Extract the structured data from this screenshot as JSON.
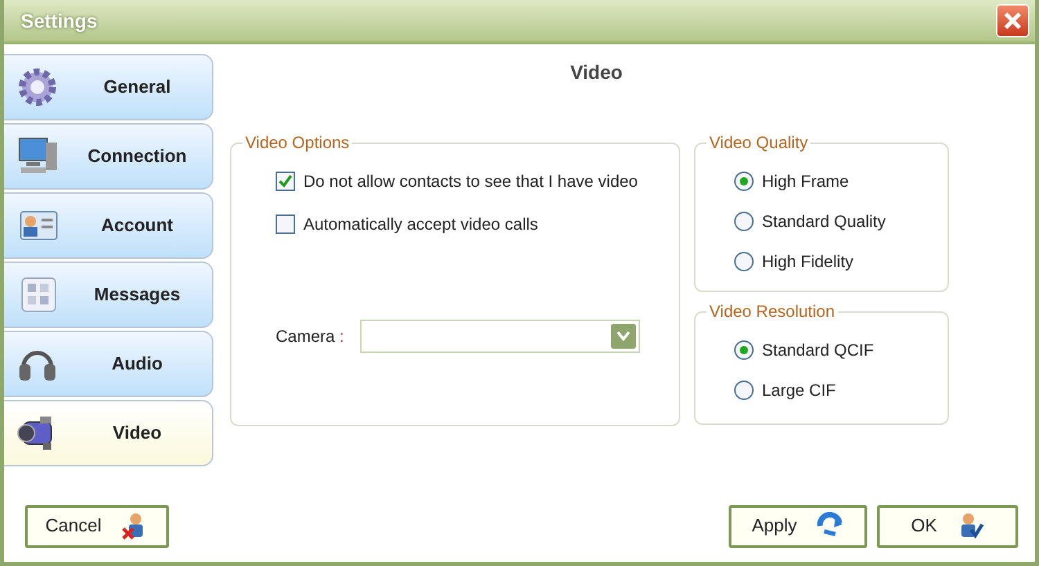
{
  "window": {
    "title": "Settings"
  },
  "sidebar": {
    "items": [
      {
        "label": "General",
        "kind": "gear",
        "selected": false
      },
      {
        "label": "Connection",
        "kind": "computer",
        "selected": false
      },
      {
        "label": "Account",
        "kind": "card",
        "selected": false
      },
      {
        "label": "Messages",
        "kind": "grid",
        "selected": false
      },
      {
        "label": "Audio",
        "kind": "headphones",
        "selected": false
      },
      {
        "label": "Video",
        "kind": "camera",
        "selected": true
      }
    ]
  },
  "heading": "Video",
  "video_options": {
    "title": "Video Options",
    "checkboxes": [
      {
        "label": "Do not allow contacts to see that I have video",
        "checked": true
      },
      {
        "label": "Automatically accept video calls",
        "checked": false
      }
    ],
    "camera": {
      "label": "Camera",
      "separator": ":"
    }
  },
  "video_quality": {
    "title": "Video Quality",
    "options": [
      {
        "label": "High Frame",
        "selected": true
      },
      {
        "label": "Standard Quality",
        "selected": false
      },
      {
        "label": "High Fidelity",
        "selected": false
      }
    ]
  },
  "video_resolution": {
    "title": "Video Resolution",
    "options": [
      {
        "label": "Standard QCIF",
        "selected": true
      },
      {
        "label": "Large CIF",
        "selected": false
      }
    ]
  },
  "buttons": [
    {
      "label": "Cancel",
      "kind": "cancel"
    },
    {
      "label": "Apply",
      "kind": "apply"
    },
    {
      "label": "OK",
      "kind": "ok"
    }
  ]
}
